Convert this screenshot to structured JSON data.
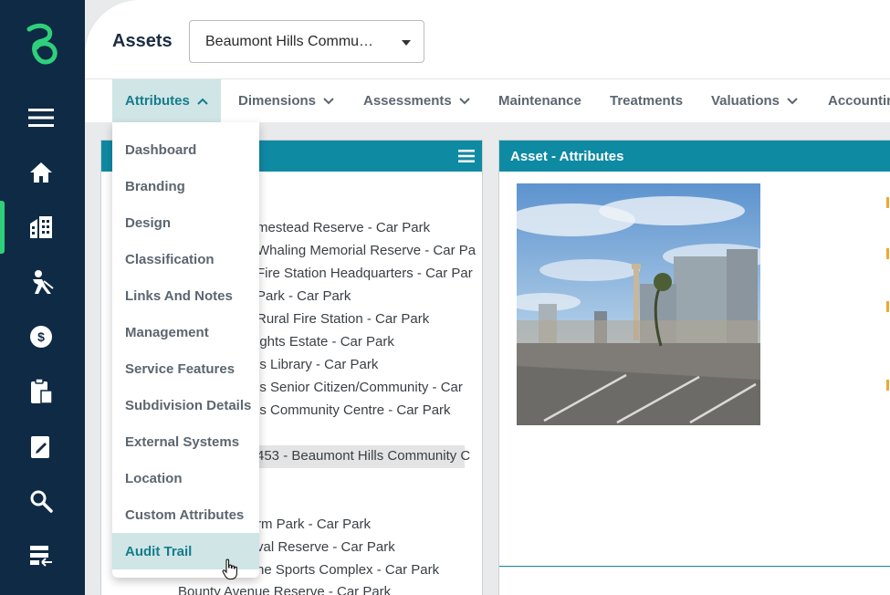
{
  "rail": {
    "icons": [
      "logo-icon",
      "menu-icon",
      "home-icon",
      "buildings-icon",
      "worker-icon",
      "finance-icon",
      "clipboard-icon",
      "edit-icon",
      "search-icon",
      "tasks-icon"
    ],
    "active": "buildings-icon",
    "accent_color": "#2ed07a"
  },
  "header": {
    "title": "Assets",
    "asset_select_value": "Beaumont Hills Commu…"
  },
  "tabs": [
    {
      "label": "Attributes",
      "active": true,
      "has_chevron": true
    },
    {
      "label": "Dimensions",
      "has_chevron": true
    },
    {
      "label": "Assessments",
      "has_chevron": true
    },
    {
      "label": "Maintenance",
      "has_chevron": false
    },
    {
      "label": "Treatments",
      "has_chevron": false
    },
    {
      "label": "Valuations",
      "has_chevron": true
    },
    {
      "label": "Accounting",
      "has_chevron": false
    }
  ],
  "attributes_menu": [
    "Dashboard",
    "Branding",
    "Design",
    "Classification",
    "Links And Notes",
    "Management",
    "Service Features",
    "Subdivision Details",
    "External Systems",
    "Location",
    "Custom Attributes",
    "Audit Trail"
  ],
  "attributes_menu_hovered": "Audit Trail",
  "tree": {
    "items": [
      "mestead Reserve - Car Park",
      "Whaling Memorial Reserve - Car Pa",
      "Fire Station Headquarters - Car Par",
      "Park - Car Park",
      "Rural Fire Station - Car Park",
      "ights Estate - Car Park",
      "ls Library - Car Park",
      "ls Senior Citizen/Community - Car",
      "ls Community Centre - Car Park",
      "453 - Beaumont Hills Community C",
      "rm Park - Car Park",
      "val Reserve - Car Park",
      "he Sports Complex - Car Park",
      "Bounty Avenue Reserve - Car Park"
    ],
    "selected_index": 9
  },
  "right_panel": {
    "title": "Asset - Attributes"
  },
  "colors": {
    "brand_teal": "#0f8aa3",
    "rail_navy": "#0f2a44",
    "highlight": "#cfe5e6",
    "accent_orange": "#f0a830"
  }
}
